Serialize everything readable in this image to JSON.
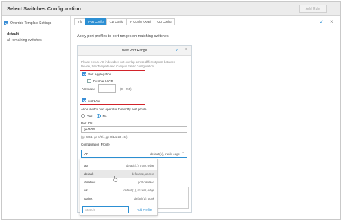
{
  "window": {
    "title": "Select Switches Configuration",
    "add_rule": "Add Rule"
  },
  "sidebar": {
    "override_label": "Override Template Settings",
    "override_checked": true,
    "items": [
      {
        "label": "default"
      },
      {
        "label": "all remaining switches"
      }
    ]
  },
  "tabs": [
    {
      "label": "Info",
      "active": false
    },
    {
      "label": "Port Config",
      "active": true
    },
    {
      "label": "CLI Config",
      "active": false
    },
    {
      "label": "IP Config (OOB)",
      "active": false
    },
    {
      "label": "CLI Config",
      "active": false
    }
  ],
  "main": {
    "section_title": "Apply port profiles to port ranges on matching switches"
  },
  "panel": {
    "title": "New Port Range",
    "warning": "Please ensure AE index does not overlap across different ports between Device, Site/Template and Campus Fabric configuration",
    "port_aggregation": {
      "label": "Port Aggregation",
      "checked": true
    },
    "disable_lacp": {
      "label": "Disable LACP",
      "checked": false
    },
    "ae_index": {
      "label": "AE Index",
      "value": "",
      "range": "(0 - 255)"
    },
    "esi_lag": {
      "label": "ESI-LAG",
      "checked": true
    },
    "allow_modify": {
      "label": "Allow switch port operator to modify port profile",
      "yes": "Yes",
      "no": "No",
      "selected": "No"
    },
    "port_ids": {
      "label": "Port IDs",
      "value": "ge-0/0/5",
      "hint": "(ge-0/0/1, ge-0/0/4, ge-0/1/1-23, etc)"
    },
    "config_profile": {
      "label": "Configuration Profile",
      "selected_name": "AP",
      "selected_desc": "default(1), trunk, edge"
    }
  },
  "dropdown": {
    "options": [
      {
        "name": "ap",
        "desc": "default(1), trunk, edge"
      },
      {
        "name": "default",
        "desc": "default(1), access"
      },
      {
        "name": "disabled",
        "desc": "port disabled"
      },
      {
        "name": "iot",
        "desc": "default(1), access, edge"
      },
      {
        "name": "uplink",
        "desc": "default(1), trunk"
      }
    ],
    "search_placeholder": "Search",
    "add_profile": "Add Profile",
    "highlighted": "default"
  },
  "colors": {
    "accent": "#2c8fd3",
    "highlight_box": "#d2232a",
    "header_bg": "#ececec"
  }
}
